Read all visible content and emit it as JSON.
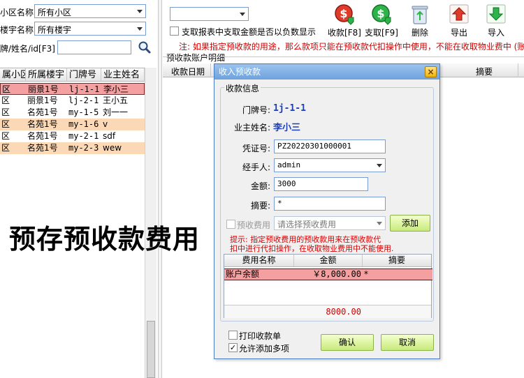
{
  "filters": {
    "community_label": "小区名称:",
    "community_value": "所有小区",
    "building_label": "楼宇名称:",
    "building_value": "所有楼宇",
    "search_label": "牌/姓名/id[F3]",
    "search_value": ""
  },
  "left_grid": {
    "columns": [
      "属小区",
      "所属楼宇",
      "门牌号",
      "业主姓名"
    ],
    "rows": [
      {
        "c0": "区",
        "c1": "丽景1号",
        "c2": "lj-1-1",
        "c3": "李小三",
        "style": "selected"
      },
      {
        "c0": "区",
        "c1": "丽景1号",
        "c2": "lj-2-1",
        "c3": "王小五",
        "style": "normal"
      },
      {
        "c0": "区",
        "c1": "名苑1号",
        "c2": "my-1-5",
        "c3": "刘一一",
        "style": "normal"
      },
      {
        "c0": "区",
        "c1": "名苑1号",
        "c2": "my-1-6",
        "c3": "v",
        "style": "peach"
      },
      {
        "c0": "区",
        "c1": "名苑1号",
        "c2": "my-2-1",
        "c3": "sdf",
        "style": "normal"
      },
      {
        "c0": "区",
        "c1": "名苑1号",
        "c2": "my-2-3",
        "c3": "wew",
        "style": "peach"
      }
    ]
  },
  "toolbar": {
    "account_select_value": "",
    "negative_checkbox_label": "支取报表中支取金额是否以负数显示",
    "note": "注: 如果指定预收款的用途，那么款项只能在预收款代扣操作中使用，不能在收取物业费中 (账",
    "buttons": [
      {
        "label": "收款[F8]",
        "icon": "receive-money-icon"
      },
      {
        "label": "支取[F9]",
        "icon": "withdraw-money-icon"
      },
      {
        "label": "删除",
        "icon": "recycle-bin-icon"
      },
      {
        "label": "导出",
        "icon": "export-arrow-icon"
      },
      {
        "label": "导入",
        "icon": "import-arrow-icon"
      }
    ]
  },
  "detail_section": {
    "title": "预收款账户明细",
    "columns": [
      "收款日期",
      "摘要"
    ]
  },
  "dialog": {
    "title": "收入预收款",
    "close_label": "×",
    "group_title": "收款信息",
    "door_label": "门牌号:",
    "door_value": "1j-1-1",
    "owner_label": "业主姓名:",
    "owner_value": "李小三",
    "voucher_label": "凭证号:",
    "voucher_value": "PZ20220301000001",
    "handler_label": "经手人:",
    "handler_value": "admin",
    "amount_label": "金额:",
    "amount_value": "3000",
    "summary_label": "摘要:",
    "summary_value": "*",
    "fee_checkbox_label": "预收费用",
    "fee_select_placeholder": "请选择预收费用",
    "add_button": "添加",
    "hint_line1": "提示: 指定预收费用的预收款用来在预收款代",
    "hint_line2": "扣中进行代扣操作，在收取物业费用中不能使用.",
    "fee_grid": {
      "columns": [
        "费用名称",
        "金额",
        "摘要"
      ],
      "row": {
        "name": "账户余额",
        "amount": "￥8,000.00",
        "summary": "*"
      },
      "total": "8000.00"
    },
    "print_receipt_label": "打印收款单",
    "print_receipt_checked": false,
    "allow_multiple_label": "允许添加多项",
    "allow_multiple_checked": true,
    "ok_button": "确认",
    "cancel_button": "取消"
  },
  "overlay_caption": "预存预收款费用",
  "colors": {
    "selected_row": "#f4a0a0",
    "peach_row": "#fcd9b6",
    "hint_red": "#d40000",
    "link_blue": "#1d3fb5"
  }
}
